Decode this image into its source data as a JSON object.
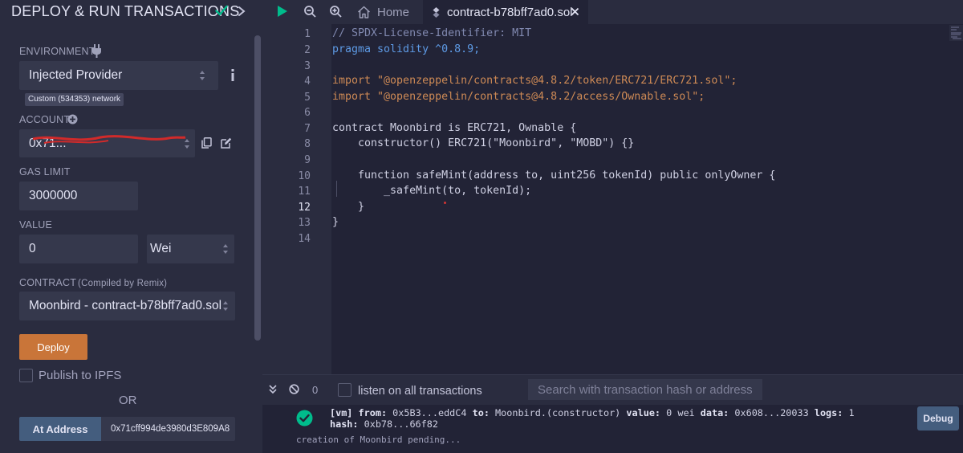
{
  "panel": {
    "title": "DEPLOY & RUN TRANSACTIONS",
    "environment_label": "ENVIRONMENT",
    "environment_value": "Injected Provider",
    "network_badge": "Custom (534353) network",
    "account_label": "ACCOUNT",
    "account_value": "0x71...",
    "gas_limit_label": "GAS LIMIT",
    "gas_limit_value": "3000000",
    "value_label": "VALUE",
    "value_amount": "0",
    "value_unit": "Wei",
    "contract_label": "CONTRACT",
    "contract_sublabel": "(Compiled by Remix)",
    "contract_value": "Moonbird - contract-b78bff7ad0.sol",
    "deploy_label": "Deploy",
    "publish_label": "Publish to IPFS",
    "or_label": "OR",
    "at_address_label": "At Address",
    "at_address_value": "0x71cff994de3980d3E809A8"
  },
  "tabs": {
    "home_label": "Home",
    "file_label": "contract-b78bff7ad0.sol"
  },
  "editor": {
    "active_line": 12,
    "line_numbers": [
      "1",
      "2",
      "3",
      "4",
      "5",
      "6",
      "7",
      "8",
      "9",
      "10",
      "11",
      "12",
      "13",
      "14"
    ],
    "lines": [
      "// SPDX-License-Identifier: MIT",
      "pragma solidity ^0.8.9;",
      "",
      "import \"@openzeppelin/contracts@4.8.2/token/ERC721/ERC721.sol\";",
      "import \"@openzeppelin/contracts@4.8.2/access/Ownable.sol\";",
      "",
      "contract Moonbird is ERC721, Ownable {",
      "    constructor() ERC721(\"Moonbird\", \"MOBD\") {}",
      "",
      "    function safeMint(address to, uint256 tokenId) public onlyOwner {",
      "        _safeMint(to, tokenId);",
      "    }",
      "}",
      ""
    ]
  },
  "terminal": {
    "pending_count": "0",
    "listen_label": "listen on all transactions",
    "search_placeholder": "Search with transaction hash or address",
    "tx": {
      "tag": "[vm]",
      "from_label": "from:",
      "from_value": "0x5B3...eddC4",
      "to_label": "to:",
      "to_value": "Moonbird.(constructor)",
      "value_label": "value:",
      "value_value": "0 wei",
      "data_label": "data:",
      "data_value": "0x608...20033",
      "logs_label": "logs:",
      "logs_value": "1",
      "hash_label": "hash:",
      "hash_value": "0xb78...66f82"
    },
    "debug_label": "Debug",
    "pending_message": "creation of Moonbird pending..."
  },
  "colors": {
    "accent_orange": "#c97539",
    "accent_blue": "#445d7e",
    "success_green": "#00bc8c",
    "play_green": "#00bc8c"
  }
}
